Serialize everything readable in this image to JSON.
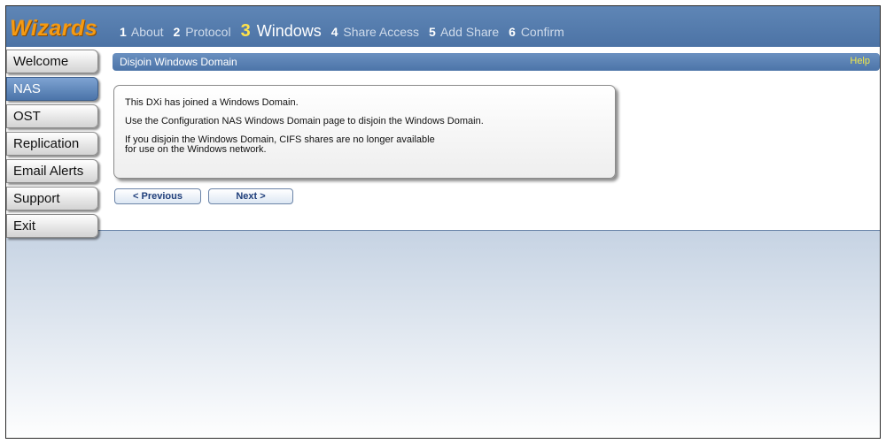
{
  "app": {
    "logo": "Wizards"
  },
  "steps": [
    {
      "num": "1",
      "label": "About"
    },
    {
      "num": "2",
      "label": "Protocol"
    },
    {
      "num": "3",
      "label": "Windows"
    },
    {
      "num": "4",
      "label": "Share Access"
    },
    {
      "num": "5",
      "label": "Add Share"
    },
    {
      "num": "6",
      "label": "Confirm"
    }
  ],
  "active_step": "3",
  "sidebar": {
    "items": [
      {
        "label": "Welcome"
      },
      {
        "label": "NAS"
      },
      {
        "label": "OST"
      },
      {
        "label": "Replication"
      },
      {
        "label": "Email Alerts"
      },
      {
        "label": "Support"
      },
      {
        "label": "Exit"
      }
    ],
    "active_item": "NAS"
  },
  "panel": {
    "title": "Disjoin Windows Domain",
    "help_label": "Help"
  },
  "message": {
    "line1": "This DXi has joined a Windows Domain.",
    "line2": "Use the Configuration NAS Windows Domain page to disjoin the Windows Domain.",
    "line3a": "If you disjoin the Windows Domain, CIFS shares are no longer available",
    "line3b": "for use on the Windows network."
  },
  "buttons": {
    "previous_label": "< Previous",
    "next_label": "Next >"
  },
  "colors": {
    "header_blue": "#4c73a5",
    "logo_orange": "#f59a12",
    "active_step_yellow": "#ffe24a",
    "help_yellow": "#f0e84a"
  }
}
